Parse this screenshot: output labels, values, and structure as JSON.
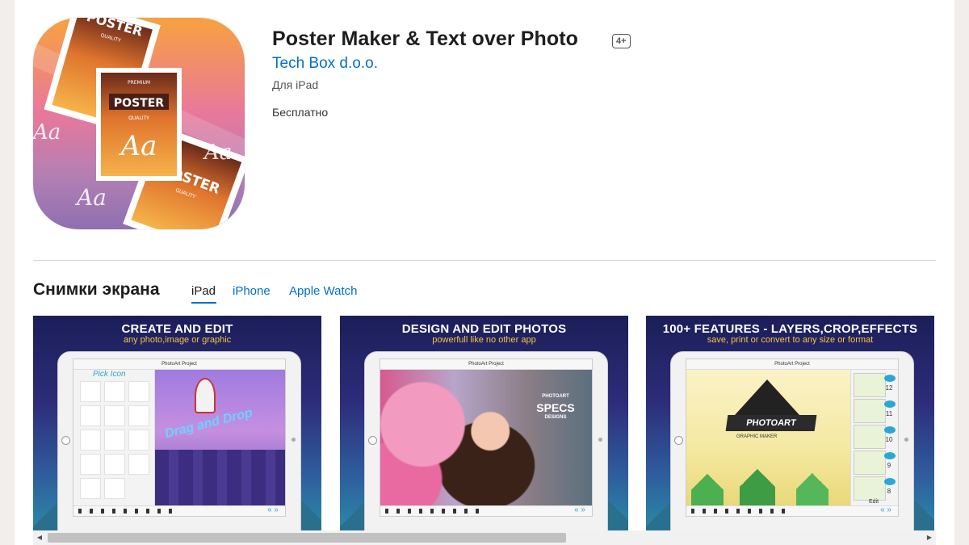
{
  "app": {
    "title": "Poster Maker & Text over Photo",
    "age_rating": "4+",
    "developer": "Tech Box d.o.o.",
    "platform": "Для iPad",
    "price": "Бесплатно"
  },
  "icon_art": {
    "poster_label": "POSTER",
    "premium_label": "PREMIUM",
    "quality_label": "QUALITY",
    "aa_label": "Aa"
  },
  "screenshots": {
    "title": "Снимки экрана",
    "tabs": [
      {
        "label": "iPad",
        "active": true
      },
      {
        "label": "iPhone",
        "active": false
      },
      {
        "label": "Apple Watch",
        "active": false
      }
    ],
    "items": [
      {
        "heading": "CREATE AND EDIT",
        "subheading": "any photo,image or graphic",
        "screen_title": "PhotoArt Project",
        "pick_label": "Pick Icon",
        "drag_label": "Drag and Drop"
      },
      {
        "heading": "DESIGN AND EDIT PHOTOS",
        "subheading": "powerfull like no other app",
        "screen_title": "PhotoArt Project",
        "brand_top": "PHOTOART",
        "brand_main": "SPECS",
        "brand_bottom": "DESIGNS"
      },
      {
        "heading": "100+ FEATURES - LAYERS,CROP,EFFECTS",
        "subheading": "save, print or convert to any size or format",
        "screen_title": "PhotoArt Project",
        "banner": "PHOTOART",
        "banner_sub": "GRAPHIC MAKER",
        "layer_numbers": [
          "12",
          "11",
          "10",
          "9",
          "8"
        ],
        "layer_edit": "Edit"
      }
    ]
  },
  "colors": {
    "link": "#0070c9",
    "accent_blue": "#2aa7d6"
  }
}
